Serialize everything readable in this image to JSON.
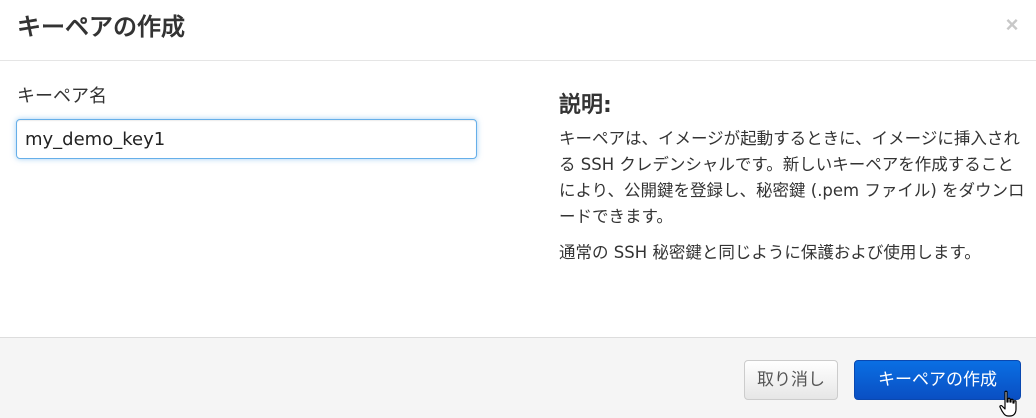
{
  "header": {
    "title": "キーペアの作成",
    "close_symbol": "×"
  },
  "form": {
    "keypair_name_label": "キーペア名",
    "keypair_name_value": "my_demo_key1"
  },
  "description": {
    "heading": "説明:",
    "paragraph_1": "キーペアは、イメージが起動するときに、イメージに挿入される SSH クレデンシャルです。新しいキーペアを作成することにより、公開鍵を登録し、秘密鍵 (.pem ファイル) をダウンロードできます。",
    "paragraph_2": "通常の SSH 秘密鍵と同じように保護および使用します。"
  },
  "footer": {
    "cancel_label": "取り消し",
    "submit_label": "キーペアの作成"
  },
  "colors": {
    "primary_button": "#0a5fd6",
    "input_focus_border": "#66afe9",
    "footer_background": "#f5f5f5"
  },
  "icons": {
    "close": "close-icon",
    "cursor": "hand-pointer-icon"
  }
}
